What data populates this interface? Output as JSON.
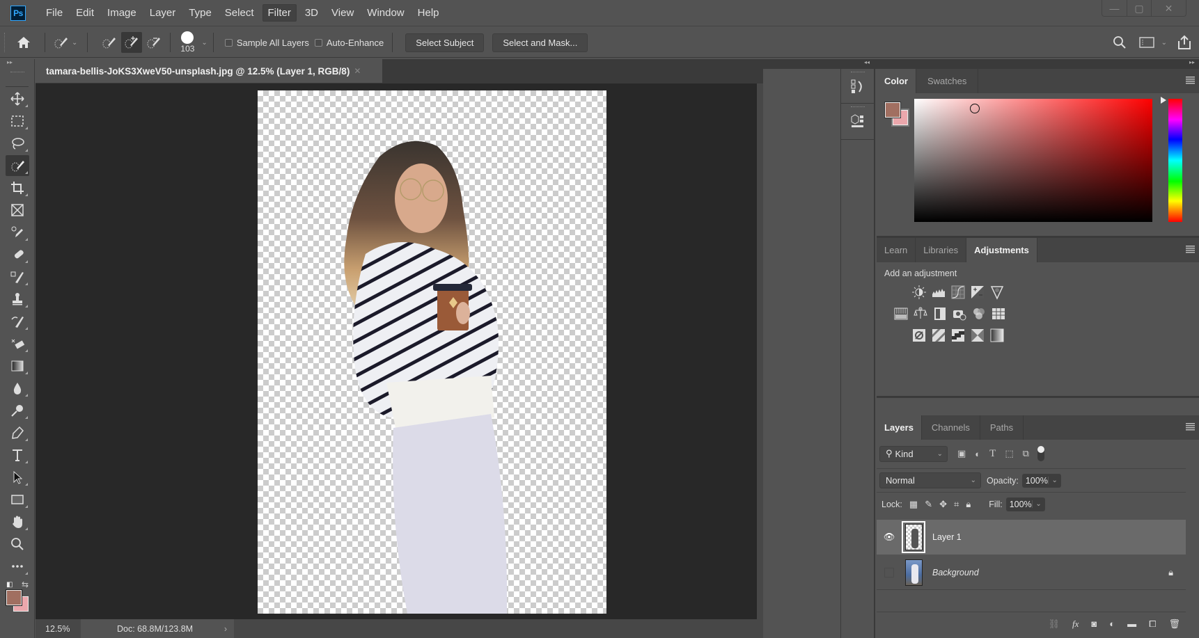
{
  "app": {
    "name": "Photoshop",
    "logo_text": "Ps"
  },
  "menu": [
    "File",
    "Edit",
    "Image",
    "Layer",
    "Type",
    "Select",
    "Filter",
    "3D",
    "View",
    "Window",
    "Help"
  ],
  "menu_active": "Filter",
  "window_controls": {
    "minimize": "—",
    "maximize": "▢",
    "close": "✕"
  },
  "options_bar": {
    "brush_size": "103",
    "sample_all_layers": {
      "label": "Sample All Layers",
      "checked": false
    },
    "auto_enhance": {
      "label": "Auto-Enhance",
      "checked": false
    },
    "select_subject": "Select Subject",
    "select_and_mask": "Select and Mask..."
  },
  "tools": [
    "move",
    "rectangular-marquee",
    "lasso",
    "quick-selection",
    "crop",
    "frame",
    "eyedropper",
    "spot-healing-brush",
    "brush",
    "clone-stamp",
    "history-brush",
    "eraser",
    "gradient",
    "blur",
    "dodge",
    "pen",
    "type",
    "path-selection",
    "rectangle",
    "hand",
    "zoom",
    "edit-toolbar"
  ],
  "active_tool": "quick-selection",
  "colors": {
    "foreground": "#a16f61",
    "background": "#eba7ac",
    "accent": "#31a8ff"
  },
  "document": {
    "tab_title": "tamara-bellis-JoKS3XweV50-unsplash.jpg @ 12.5% (Layer 1, RGB/8)",
    "close": "✕",
    "zoom": "12.5%",
    "doc_info": "Doc: 68.8M/123.8M",
    "info_arrow": "›"
  },
  "color_panel": {
    "tabs": [
      "Color",
      "Swatches"
    ],
    "active": "Color"
  },
  "adjust_panel": {
    "tabs": [
      "Learn",
      "Libraries",
      "Adjustments"
    ],
    "active": "Adjustments",
    "heading": "Add an adjustment",
    "rows": [
      [
        "brightness-contrast",
        "levels",
        "curves",
        "exposure",
        "vibrance"
      ],
      [
        "hue-saturation",
        "color-balance",
        "black-white",
        "photo-filter",
        "channel-mixer",
        "color-lookup"
      ],
      [
        "invert",
        "posterize",
        "threshold",
        "selective-color",
        "gradient-map"
      ]
    ]
  },
  "layers_panel": {
    "tabs": [
      "Layers",
      "Channels",
      "Paths"
    ],
    "active": "Layers",
    "filter_kind": "Kind",
    "blend_mode": "Normal",
    "opacity_label": "Opacity:",
    "opacity": "100%",
    "lock_label": "Lock:",
    "fill_label": "Fill:",
    "fill": "100%",
    "layers": [
      {
        "name": "Layer 1",
        "visible": true,
        "selected": true,
        "locked": false
      },
      {
        "name": "Background",
        "visible": false,
        "selected": false,
        "locked": true
      }
    ],
    "footer": [
      "link-layers",
      "fx",
      "add-mask",
      "adjustment-layer",
      "new-group",
      "new-layer",
      "delete-layer"
    ]
  }
}
